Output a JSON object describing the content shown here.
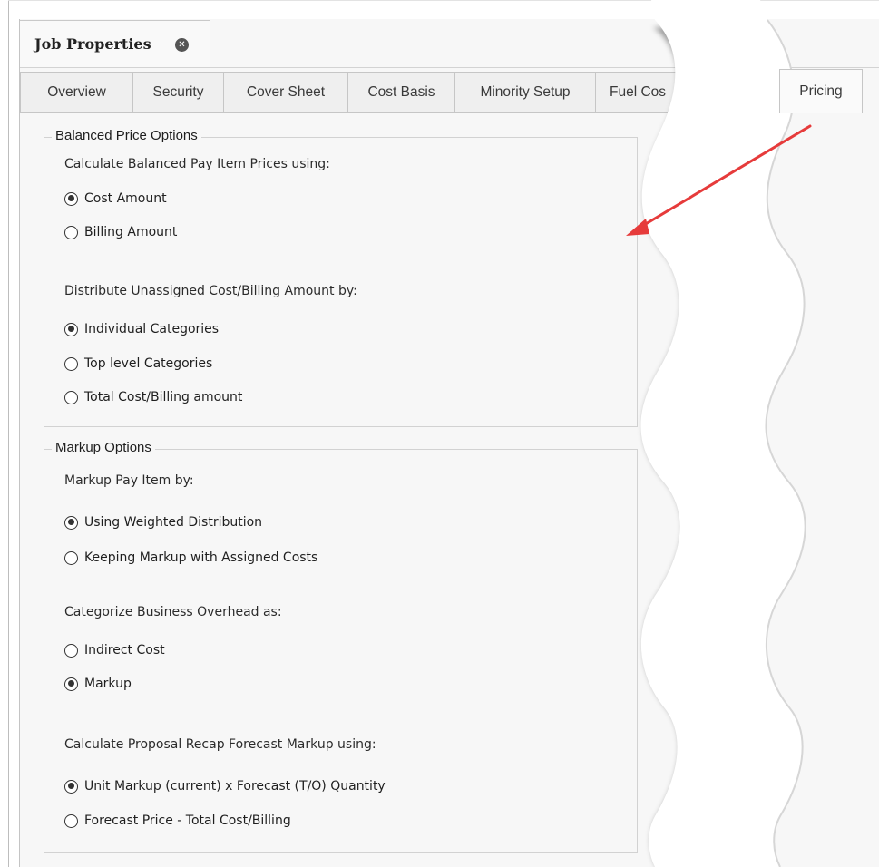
{
  "document_tab": {
    "title": "Job Properties",
    "close_icon": "close-circle-icon"
  },
  "tabs": [
    {
      "label": "Overview"
    },
    {
      "label": "Security"
    },
    {
      "label": "Cover Sheet"
    },
    {
      "label": "Cost Basis"
    },
    {
      "label": "Minority Setup"
    },
    {
      "label": "Fuel Cos"
    },
    {
      "label": "Pricing",
      "selected": true
    }
  ],
  "balanced_price": {
    "group_title": "Balanced Price Options",
    "calc_prompt": "Calculate Balanced Pay Item Prices using:",
    "calc_options": [
      {
        "label": "Cost Amount",
        "checked": true
      },
      {
        "label": "Billing Amount",
        "checked": false
      }
    ],
    "distribute_prompt": "Distribute Unassigned Cost/Billing Amount by:",
    "distribute_options": [
      {
        "label": "Individual Categories",
        "checked": true
      },
      {
        "label": "Top level Categories",
        "checked": false
      },
      {
        "label": "Total Cost/Billing amount",
        "checked": false
      }
    ]
  },
  "markup": {
    "group_title": "Markup Options",
    "payitem_prompt": "Markup Pay Item by:",
    "payitem_options": [
      {
        "label": "Using Weighted Distribution",
        "checked": true
      },
      {
        "label": "Keeping Markup with Assigned Costs",
        "checked": false
      }
    ],
    "overhead_prompt": "Categorize Business Overhead as:",
    "overhead_options": [
      {
        "label": "Indirect Cost",
        "checked": false
      },
      {
        "label": "Markup",
        "checked": true
      }
    ],
    "recap_prompt": "Calculate Proposal Recap Forecast Markup using:",
    "recap_options": [
      {
        "label": "Unit Markup (current) x Forecast (T/O) Quantity",
        "checked": true
      },
      {
        "label": "Forecast Price - Total Cost/Billing",
        "checked": false
      }
    ]
  },
  "colors": {
    "annotation_arrow": "#e63b3b",
    "background": "#f7f7f7"
  }
}
